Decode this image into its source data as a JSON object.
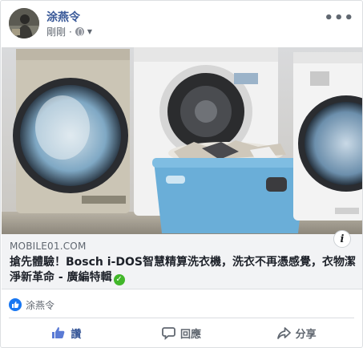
{
  "post": {
    "author": "涂燕令",
    "timestamp": "剛剛",
    "privacy_icon": "globe-icon",
    "more_icon": "more-icon"
  },
  "link_preview": {
    "domain": "MOBILE01.COM",
    "title": "搶先體驗！Bosch i-DOS智慧精算洗衣機，洗衣不再憑感覺，衣物潔淨新革命 - 廣編特輯",
    "verified_icon": "verified-check-icon",
    "info_icon": "info-icon"
  },
  "reactions": {
    "icon": "like-reaction-icon",
    "names": "涂燕令"
  },
  "actions": {
    "like_label": "讚",
    "comment_label": "回應",
    "share_label": "分享"
  },
  "colors": {
    "link_blue": "#385898",
    "like_blue": "#1877f2",
    "verified_green": "#42b72a",
    "meta_gray": "#606770"
  }
}
